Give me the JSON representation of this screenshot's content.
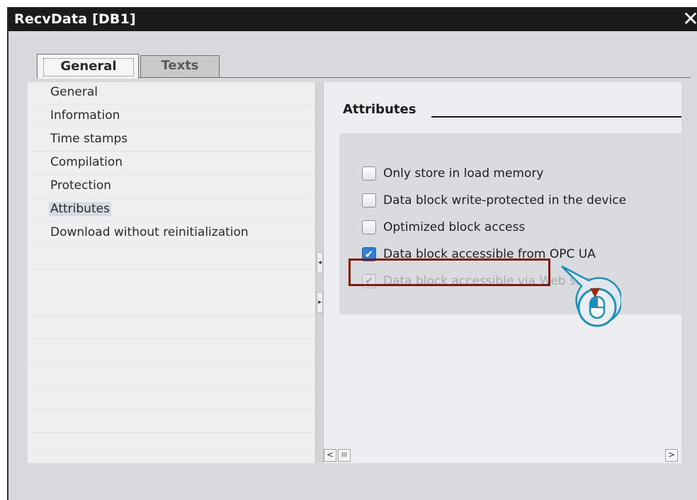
{
  "window": {
    "title": "RecvData [DB1]",
    "close_glyph": "✕"
  },
  "tabs": [
    {
      "label": "General",
      "active": true
    },
    {
      "label": "Texts",
      "active": false
    }
  ],
  "nav": {
    "items": [
      {
        "label": "General"
      },
      {
        "label": "Information"
      },
      {
        "label": "Time stamps"
      },
      {
        "label": "Compilation"
      },
      {
        "label": "Protection"
      },
      {
        "label": "Attributes",
        "selected": true
      },
      {
        "label": "Download without reinitialization"
      }
    ]
  },
  "section": {
    "title": "Attributes"
  },
  "options": [
    {
      "label": "Only store in load memory",
      "checked": false,
      "enabled": true
    },
    {
      "label": "Data block write-protected in the device",
      "checked": false,
      "enabled": true
    },
    {
      "label": "Optimized block access",
      "checked": false,
      "enabled": true
    },
    {
      "label": "Data block accessible from OPC UA",
      "checked": true,
      "enabled": true
    },
    {
      "label": "Data block accessible via Web server",
      "checked": true,
      "enabled": false
    }
  ],
  "glyphs": {
    "check": "✔",
    "collapse_left": "◂",
    "collapse_right": "▸",
    "scroll_left": "<",
    "scroll_right": ">",
    "scroll_thumb": "III"
  },
  "icons": {
    "callout": "mouse-click-icon"
  },
  "colors": {
    "highlight_border": "#7b1c12",
    "checkbox_checked": "#2f7fd6",
    "title_bar": "#1b1b1b",
    "callout_ring": "#1f8fb8"
  }
}
